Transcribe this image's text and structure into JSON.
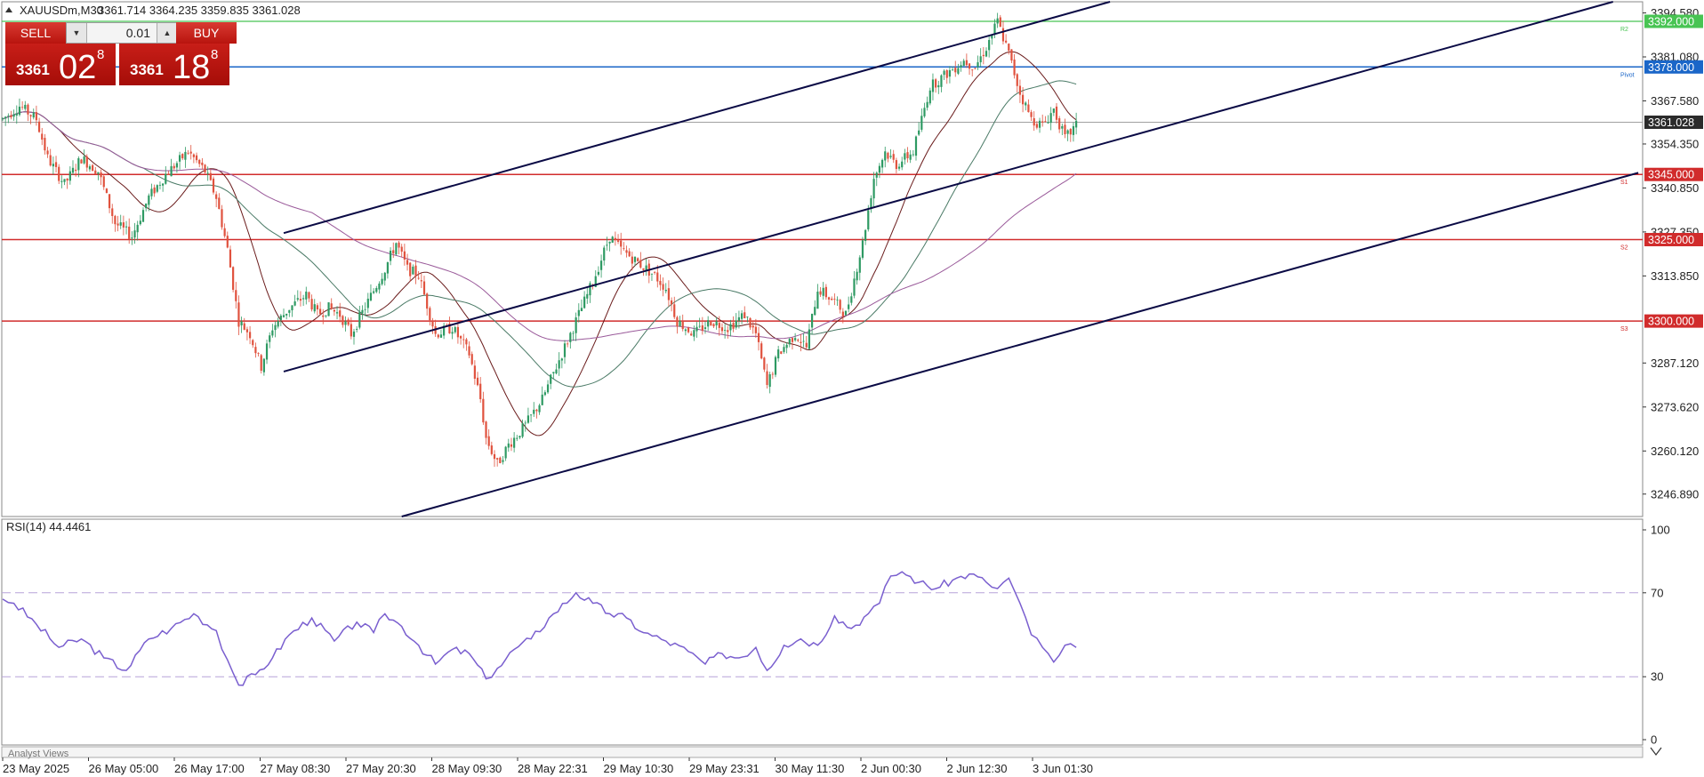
{
  "window": {
    "symbol_label": "XAUUSDm,M30",
    "ohlc_label": "3361.714 3364.235 3359.835 3361.028",
    "indicator_label": "RSI(14) 44.4461",
    "footer_label": "Analyst Views"
  },
  "trade_panel": {
    "sell_label": "SELL",
    "buy_label": "BUY",
    "volume": "0.01",
    "volume_down_icon": "triangle-down-icon",
    "volume_up_icon": "triangle-up-icon",
    "bid_small": "3361",
    "bid_big": "02",
    "bid_sup": "8",
    "ask_small": "3361",
    "ask_big": "18",
    "ask_sup": "8"
  },
  "colors": {
    "bull": "#2e9a63",
    "bear": "#e0523e",
    "channel": "#0a0a45",
    "resistance": "#48c453",
    "pivot": "#1a66c8",
    "support": "#d12c2c",
    "price_line": "#a0a0a0",
    "ma_fast": "#6a1b1b",
    "ma_mid": "#4a7a66",
    "ma_slow": "#9a5a9a",
    "rsi": "#7a5fcf"
  },
  "chart_data": [
    {
      "type": "candlestick",
      "symbol": "XAUUSDm",
      "timeframe": "M30",
      "ylim": [
        3240.0,
        3398.0
      ],
      "y_ticks": [
        "3394.580",
        "3381.080",
        "3367.580",
        "3354.350",
        "3340.850",
        "3327.350",
        "3313.850",
        "3287.120",
        "3273.620",
        "3260.120",
        "3246.890"
      ],
      "x_ticks": [
        "23 May 2025",
        "26 May 05:00",
        "26 May 17:00",
        "27 May 08:30",
        "27 May 20:30",
        "28 May 09:30",
        "28 May 22:31",
        "29 May 10:30",
        "29 May 23:31",
        "30 May 11:30",
        "2 Jun 00:30",
        "2 Jun 12:30",
        "3 Jun 01:30"
      ],
      "current_price": 3361.028,
      "levels": [
        {
          "name": "R2",
          "label": "R2",
          "value": 3392.0,
          "tag": "3392.000",
          "kind": "resistance"
        },
        {
          "name": "Pivot",
          "label": "Pivot",
          "value": 3378.0,
          "tag": "3378.000",
          "kind": "pivot"
        },
        {
          "name": "S1",
          "label": "S1",
          "value": 3345.0,
          "tag": "3345.000",
          "kind": "support"
        },
        {
          "name": "S2",
          "label": "S2",
          "value": 3325.0,
          "tag": "3325.000",
          "kind": "support"
        },
        {
          "name": "S3",
          "label": "S3",
          "value": 3300.0,
          "tag": "3300.000",
          "kind": "support"
        }
      ],
      "price_path": [
        [
          0,
          3362
        ],
        [
          6,
          3366
        ],
        [
          12,
          3362
        ],
        [
          16,
          3350
        ],
        [
          22,
          3342
        ],
        [
          28,
          3350
        ],
        [
          34,
          3346
        ],
        [
          40,
          3330
        ],
        [
          46,
          3326
        ],
        [
          52,
          3338
        ],
        [
          58,
          3345
        ],
        [
          66,
          3352
        ],
        [
          72,
          3346
        ],
        [
          76,
          3338
        ],
        [
          80,
          3322
        ],
        [
          84,
          3300
        ],
        [
          88,
          3296
        ],
        [
          92,
          3286
        ],
        [
          96,
          3298
        ],
        [
          102,
          3304
        ],
        [
          108,
          3308
        ],
        [
          112,
          3302
        ],
        [
          116,
          3304
        ],
        [
          120,
          3302
        ],
        [
          124,
          3296
        ],
        [
          130,
          3306
        ],
        [
          136,
          3316
        ],
        [
          140,
          3324
        ],
        [
          144,
          3316
        ],
        [
          148,
          3314
        ],
        [
          154,
          3296
        ],
        [
          160,
          3298
        ],
        [
          166,
          3290
        ],
        [
          170,
          3276
        ],
        [
          172,
          3264
        ],
        [
          176,
          3256
        ],
        [
          180,
          3262
        ],
        [
          186,
          3268
        ],
        [
          192,
          3276
        ],
        [
          198,
          3288
        ],
        [
          204,
          3300
        ],
        [
          210,
          3312
        ],
        [
          216,
          3326
        ],
        [
          220,
          3322
        ],
        [
          226,
          3318
        ],
        [
          232,
          3314
        ],
        [
          236,
          3310
        ],
        [
          240,
          3300
        ],
        [
          246,
          3296
        ],
        [
          252,
          3300
        ],
        [
          258,
          3298
        ],
        [
          264,
          3302
        ],
        [
          268,
          3296
        ],
        [
          272,
          3280
        ],
        [
          276,
          3290
        ],
        [
          282,
          3296
        ],
        [
          286,
          3292
        ],
        [
          290,
          3310
        ],
        [
          296,
          3306
        ],
        [
          300,
          3302
        ],
        [
          306,
          3324
        ],
        [
          310,
          3344
        ],
        [
          314,
          3352
        ],
        [
          318,
          3348
        ],
        [
          324,
          3352
        ],
        [
          330,
          3372
        ],
        [
          336,
          3376
        ],
        [
          342,
          3380
        ],
        [
          346,
          3378
        ],
        [
          350,
          3384
        ],
        [
          354,
          3392
        ],
        [
          358,
          3382
        ],
        [
          362,
          3370
        ],
        [
          366,
          3362
        ],
        [
          370,
          3360
        ],
        [
          374,
          3365
        ],
        [
          378,
          3356
        ],
        [
          382,
          3360
        ]
      ],
      "channel_lines": [
        {
          "name": "channel-upper",
          "from": [
            100,
            3327.0
          ],
          "to": [
            394,
            3398.0
          ]
        },
        {
          "name": "channel-middle",
          "from": [
            100,
            3284.5
          ],
          "to": [
            573,
            3398.0
          ]
        },
        {
          "name": "channel-lower",
          "from": [
            142,
            3240.0
          ],
          "to": [
            582,
            3345.5
          ]
        }
      ]
    },
    {
      "type": "line",
      "name": "RSI(14)",
      "ylim": [
        0,
        100
      ],
      "y_ticks": [
        "100",
        "70",
        "30",
        "0"
      ],
      "levels": [
        70,
        30
      ],
      "current_value": 44.4461,
      "x": [
        0,
        4,
        12,
        20,
        28,
        36,
        44,
        52,
        60,
        68,
        76,
        80,
        84,
        90,
        96,
        102,
        110,
        118,
        126,
        132,
        136,
        142,
        148,
        154,
        160,
        166,
        172,
        176,
        182,
        188,
        196,
        204,
        210,
        216,
        222,
        228,
        236,
        244,
        250,
        256,
        262,
        268,
        272,
        278,
        284,
        290,
        296,
        302,
        308,
        312,
        316,
        320,
        326,
        332,
        338,
        344,
        350,
        354,
        358,
        362,
        366,
        370,
        374,
        378,
        382
      ],
      "values": [
        67,
        65,
        55,
        44,
        48,
        39,
        33,
        48,
        53,
        60,
        52,
        38,
        26,
        31,
        39,
        50,
        58,
        47,
        56,
        51,
        60,
        54,
        45,
        36,
        43,
        41,
        29,
        34,
        43,
        48,
        60,
        70,
        65,
        60,
        58,
        51,
        47,
        42,
        36,
        41,
        39,
        44,
        33,
        45,
        48,
        45,
        59,
        53,
        60,
        65,
        78,
        80,
        75,
        72,
        76,
        79,
        75,
        72,
        77,
        65,
        50,
        44,
        37,
        45,
        44
      ]
    }
  ]
}
